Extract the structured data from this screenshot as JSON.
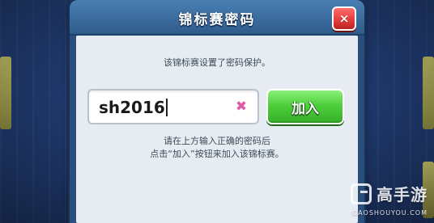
{
  "dialog": {
    "title": "锦标赛密码",
    "close_icon": "×"
  },
  "body": {
    "info": "该锦标赛设置了密码保护。",
    "password_value": "sh2016",
    "clear_icon": "✖",
    "join_label": "加入",
    "hint_line1": "请在上方输入正确的密码后",
    "hint_line2": "点击“加入”按钮来加入该锦标赛。"
  },
  "watermark": {
    "brand": "高手游",
    "domain": "GAOSHOUYOU.COM"
  },
  "colors": {
    "header": "#3a6a9c",
    "body": "#e6ecf2",
    "join_button": "#4fcf3c",
    "close_button": "#e23a3a",
    "clear_icon": "#e05aa8"
  }
}
